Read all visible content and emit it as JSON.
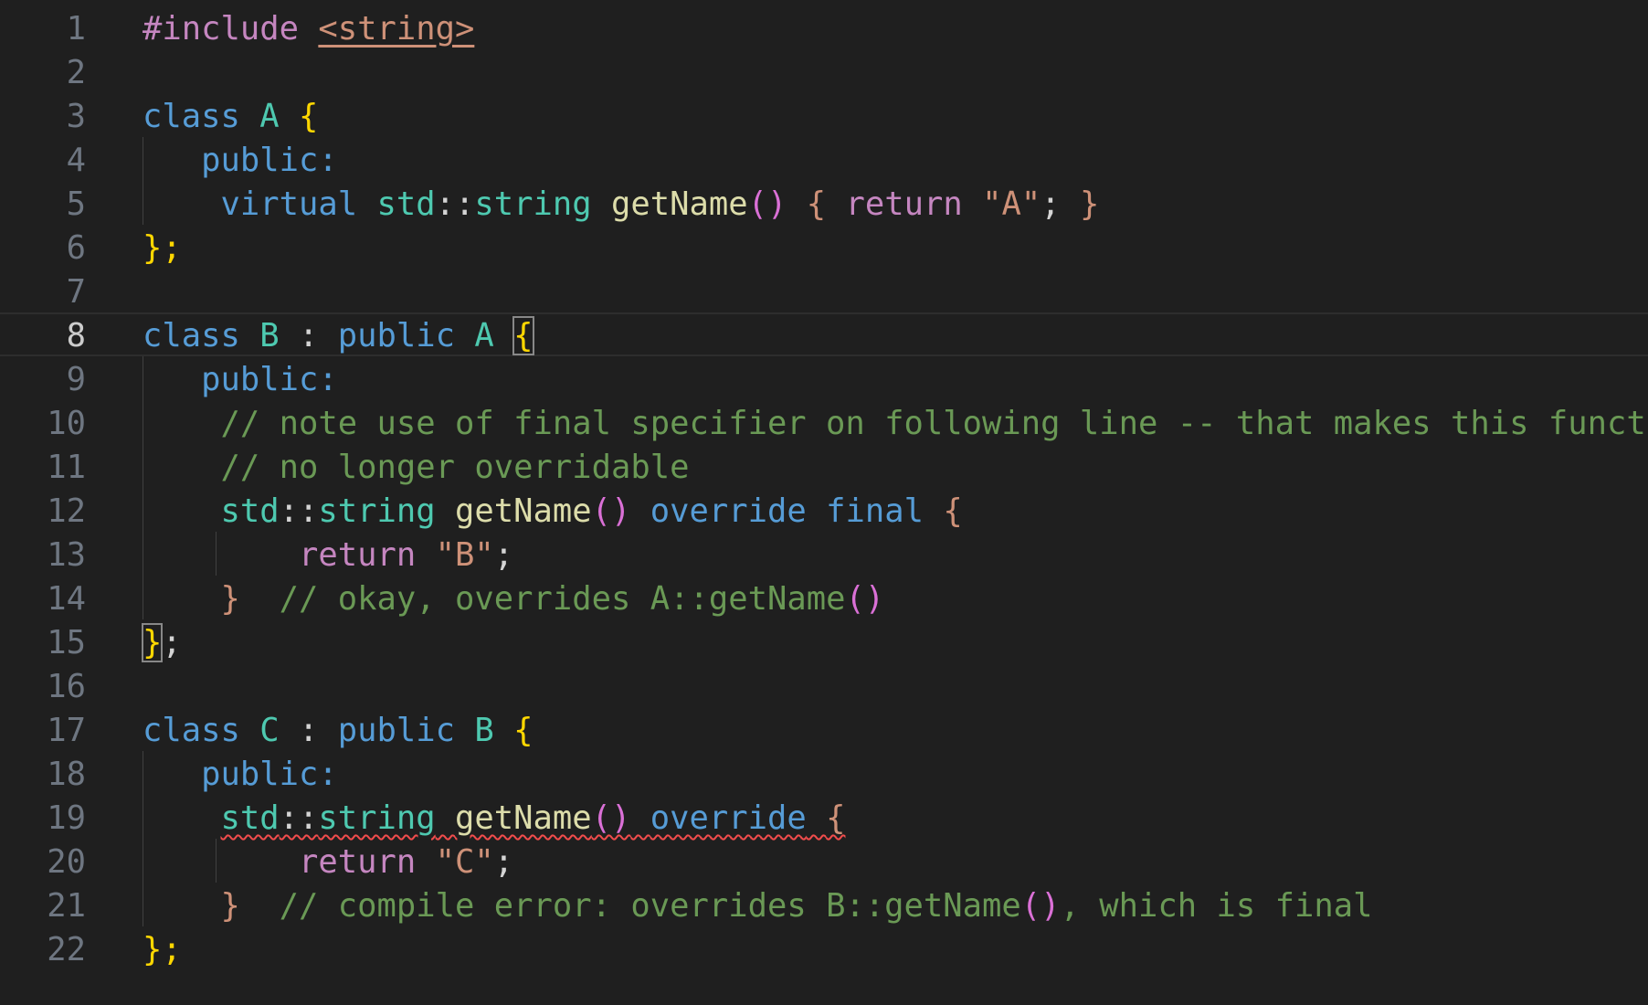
{
  "editor": {
    "language": "cpp",
    "active_line": 8,
    "colors": {
      "background": "#1f1f1f",
      "keyword": "#569cd6",
      "control": "#c586c0",
      "type": "#4ec9b0",
      "function": "#dcdcaa",
      "string": "#ce9178",
      "comment": "#6a9955",
      "error_squiggle": "#f14c4c"
    },
    "lines": [
      {
        "n": "1",
        "tokens": [
          {
            "t": "#include",
            "c": "ctl"
          },
          {
            "t": " ",
            "c": "op"
          },
          {
            "t": "<string>",
            "c": "inc"
          }
        ]
      },
      {
        "n": "2",
        "tokens": []
      },
      {
        "n": "3",
        "tokens": [
          {
            "t": "class",
            "c": "kw"
          },
          {
            "t": " ",
            "c": "op"
          },
          {
            "t": "A",
            "c": "type"
          },
          {
            "t": " ",
            "c": "op"
          },
          {
            "t": "{",
            "c": "br1"
          }
        ]
      },
      {
        "n": "4",
        "tokens": [
          {
            "t": "   ",
            "c": "op"
          },
          {
            "t": "public:",
            "c": "kw"
          }
        ]
      },
      {
        "n": "5",
        "tokens": [
          {
            "t": "    ",
            "c": "op"
          },
          {
            "t": "virtual",
            "c": "kw"
          },
          {
            "t": " ",
            "c": "op"
          },
          {
            "t": "std",
            "c": "type"
          },
          {
            "t": "::",
            "c": "op"
          },
          {
            "t": "string",
            "c": "type"
          },
          {
            "t": " ",
            "c": "op"
          },
          {
            "t": "getName",
            "c": "fn"
          },
          {
            "t": "()",
            "c": "br2"
          },
          {
            "t": " ",
            "c": "op"
          },
          {
            "t": "{",
            "c": "str"
          },
          {
            "t": " ",
            "c": "op"
          },
          {
            "t": "return",
            "c": "ctl"
          },
          {
            "t": " ",
            "c": "op"
          },
          {
            "t": "\"A\"",
            "c": "str"
          },
          {
            "t": "; ",
            "c": "op"
          },
          {
            "t": "}",
            "c": "str"
          }
        ]
      },
      {
        "n": "6",
        "tokens": [
          {
            "t": "};",
            "c": "br1"
          }
        ]
      },
      {
        "n": "7",
        "tokens": []
      },
      {
        "n": "8",
        "tokens": [
          {
            "t": "class",
            "c": "kw"
          },
          {
            "t": " ",
            "c": "op"
          },
          {
            "t": "B",
            "c": "type"
          },
          {
            "t": " : ",
            "c": "op"
          },
          {
            "t": "public",
            "c": "kw"
          },
          {
            "t": " ",
            "c": "op"
          },
          {
            "t": "A",
            "c": "type"
          },
          {
            "t": " ",
            "c": "op"
          },
          {
            "t": "{",
            "c": "br1",
            "match": true
          }
        ]
      },
      {
        "n": "9",
        "tokens": [
          {
            "t": "   ",
            "c": "op"
          },
          {
            "t": "public:",
            "c": "kw"
          }
        ]
      },
      {
        "n": "10",
        "tokens": [
          {
            "t": "    ",
            "c": "op"
          },
          {
            "t": "// note use of final specifier on following line -- that makes this function",
            "c": "cmt"
          }
        ]
      },
      {
        "n": "11",
        "tokens": [
          {
            "t": "    ",
            "c": "op"
          },
          {
            "t": "// no longer overridable",
            "c": "cmt"
          }
        ]
      },
      {
        "n": "12",
        "tokens": [
          {
            "t": "    ",
            "c": "op"
          },
          {
            "t": "std",
            "c": "type"
          },
          {
            "t": "::",
            "c": "op"
          },
          {
            "t": "string",
            "c": "type"
          },
          {
            "t": " ",
            "c": "op"
          },
          {
            "t": "getName",
            "c": "fn"
          },
          {
            "t": "()",
            "c": "br2"
          },
          {
            "t": " ",
            "c": "op"
          },
          {
            "t": "override",
            "c": "kw"
          },
          {
            "t": " ",
            "c": "op"
          },
          {
            "t": "final",
            "c": "kw"
          },
          {
            "t": " ",
            "c": "op"
          },
          {
            "t": "{",
            "c": "str"
          }
        ]
      },
      {
        "n": "13",
        "tokens": [
          {
            "t": "        ",
            "c": "op"
          },
          {
            "t": "return",
            "c": "ctl"
          },
          {
            "t": " ",
            "c": "op"
          },
          {
            "t": "\"B\"",
            "c": "str"
          },
          {
            "t": ";",
            "c": "op"
          }
        ]
      },
      {
        "n": "14",
        "tokens": [
          {
            "t": "    ",
            "c": "op"
          },
          {
            "t": "}",
            "c": "str"
          },
          {
            "t": "  ",
            "c": "op"
          },
          {
            "t": "// okay, overrides A::getName",
            "c": "cmt"
          },
          {
            "t": "()",
            "c": "br2"
          }
        ]
      },
      {
        "n": "15",
        "tokens": [
          {
            "t": "}",
            "c": "br1",
            "match": true
          },
          {
            "t": ";",
            "c": "op"
          }
        ]
      },
      {
        "n": "16",
        "tokens": []
      },
      {
        "n": "17",
        "tokens": [
          {
            "t": "class",
            "c": "kw"
          },
          {
            "t": " ",
            "c": "op"
          },
          {
            "t": "C",
            "c": "type"
          },
          {
            "t": " : ",
            "c": "op"
          },
          {
            "t": "public",
            "c": "kw"
          },
          {
            "t": " ",
            "c": "op"
          },
          {
            "t": "B",
            "c": "type"
          },
          {
            "t": " ",
            "c": "op"
          },
          {
            "t": "{",
            "c": "br1"
          }
        ]
      },
      {
        "n": "18",
        "tokens": [
          {
            "t": "   ",
            "c": "op"
          },
          {
            "t": "public:",
            "c": "kw"
          }
        ]
      },
      {
        "n": "19",
        "tokens": [
          {
            "t": "    ",
            "c": "op"
          },
          {
            "t": "std",
            "c": "type",
            "err": true
          },
          {
            "t": "::",
            "c": "op",
            "err": true
          },
          {
            "t": "string",
            "c": "type",
            "err": true
          },
          {
            "t": " ",
            "c": "op",
            "err": true
          },
          {
            "t": "getName",
            "c": "fn",
            "err": true
          },
          {
            "t": "()",
            "c": "br2",
            "err": true
          },
          {
            "t": " ",
            "c": "op",
            "err": true
          },
          {
            "t": "override",
            "c": "kw",
            "err": true
          },
          {
            "t": " ",
            "c": "op",
            "err": true
          },
          {
            "t": "{",
            "c": "str",
            "err": true
          }
        ]
      },
      {
        "n": "20",
        "tokens": [
          {
            "t": "        ",
            "c": "op"
          },
          {
            "t": "return",
            "c": "ctl"
          },
          {
            "t": " ",
            "c": "op"
          },
          {
            "t": "\"C\"",
            "c": "str"
          },
          {
            "t": ";",
            "c": "op"
          }
        ]
      },
      {
        "n": "21",
        "tokens": [
          {
            "t": "    ",
            "c": "op"
          },
          {
            "t": "}",
            "c": "str"
          },
          {
            "t": "  ",
            "c": "op"
          },
          {
            "t": "// compile error: overrides B::getName",
            "c": "cmt"
          },
          {
            "t": "()",
            "c": "br2"
          },
          {
            "t": ", which is final",
            "c": "cmt"
          }
        ]
      },
      {
        "n": "22",
        "tokens": [
          {
            "t": "};",
            "c": "br1"
          }
        ]
      }
    ]
  }
}
